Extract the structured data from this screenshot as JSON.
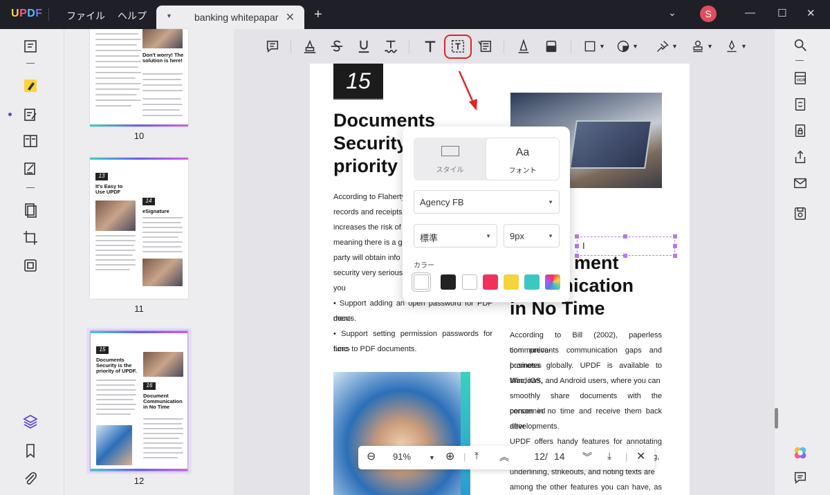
{
  "app": {
    "logo": "UPDF",
    "menu": [
      "ファイル",
      "ヘルプ"
    ],
    "tab_title": "banking whitepapar",
    "avatar_initial": "S"
  },
  "thumbnails": [
    {
      "page": "10",
      "heading": "Don't worry! The solution is here!"
    },
    {
      "page": "11",
      "badge1": "13",
      "heading1": "It's Easy to Use UPDF",
      "badge2": "14",
      "heading2": "eSignature"
    },
    {
      "page": "12",
      "badge1": "15",
      "heading1": "Documents Security is the priority of UPDF.",
      "badge2": "16",
      "heading2": "Document Communication in No Time"
    }
  ],
  "document": {
    "page_number_badge": "15",
    "left_heading": [
      "Documents",
      "Security",
      "priority"
    ],
    "left_body": [
      "According to Flaherty",
      "records and receipts",
      "increases the risk of se",
      "meaning there is a gre",
      "party will obtain info",
      "security very seriousl",
      "you",
      "• Support adding an open password for PDF docu-",
      "ments.",
      "• Support setting permission passwords for func-",
      "tions to PDF documents."
    ],
    "right_heading": [
      "ment",
      "unication",
      "in No Time"
    ],
    "right_body": [
      "According to Bill (2002), paperless communica-",
      "tion prevents communication gaps and promotes",
      "business globally. UPDF is available to Windows,",
      "Mac, iOS, and Android users, where you can",
      "smoothly share documents with the concerned",
      "person in no time and receive them back after",
      "developments.",
      "UPDF offers handy features for annotating and",
      "underlining, strikeouts, and noting texts are",
      "among the other features you can have, as well as"
    ],
    "right_body_extra": "g,",
    "text_cursor": "I"
  },
  "popup": {
    "tab_style": "スタイル",
    "tab_font": "フォント",
    "tab_font_icon": "Aa",
    "font_family": "Agency FB",
    "font_weight": "標準",
    "font_size": "9px",
    "color_label": "カラー",
    "colors": [
      "#ffffff",
      "#222222",
      "#ffffff",
      "#f0325a",
      "#f5d33c",
      "#3cc8c0",
      "rainbow"
    ]
  },
  "zoom": {
    "zoom_value": "91%",
    "current_page": "12",
    "separator": "/",
    "total_pages": "14"
  }
}
